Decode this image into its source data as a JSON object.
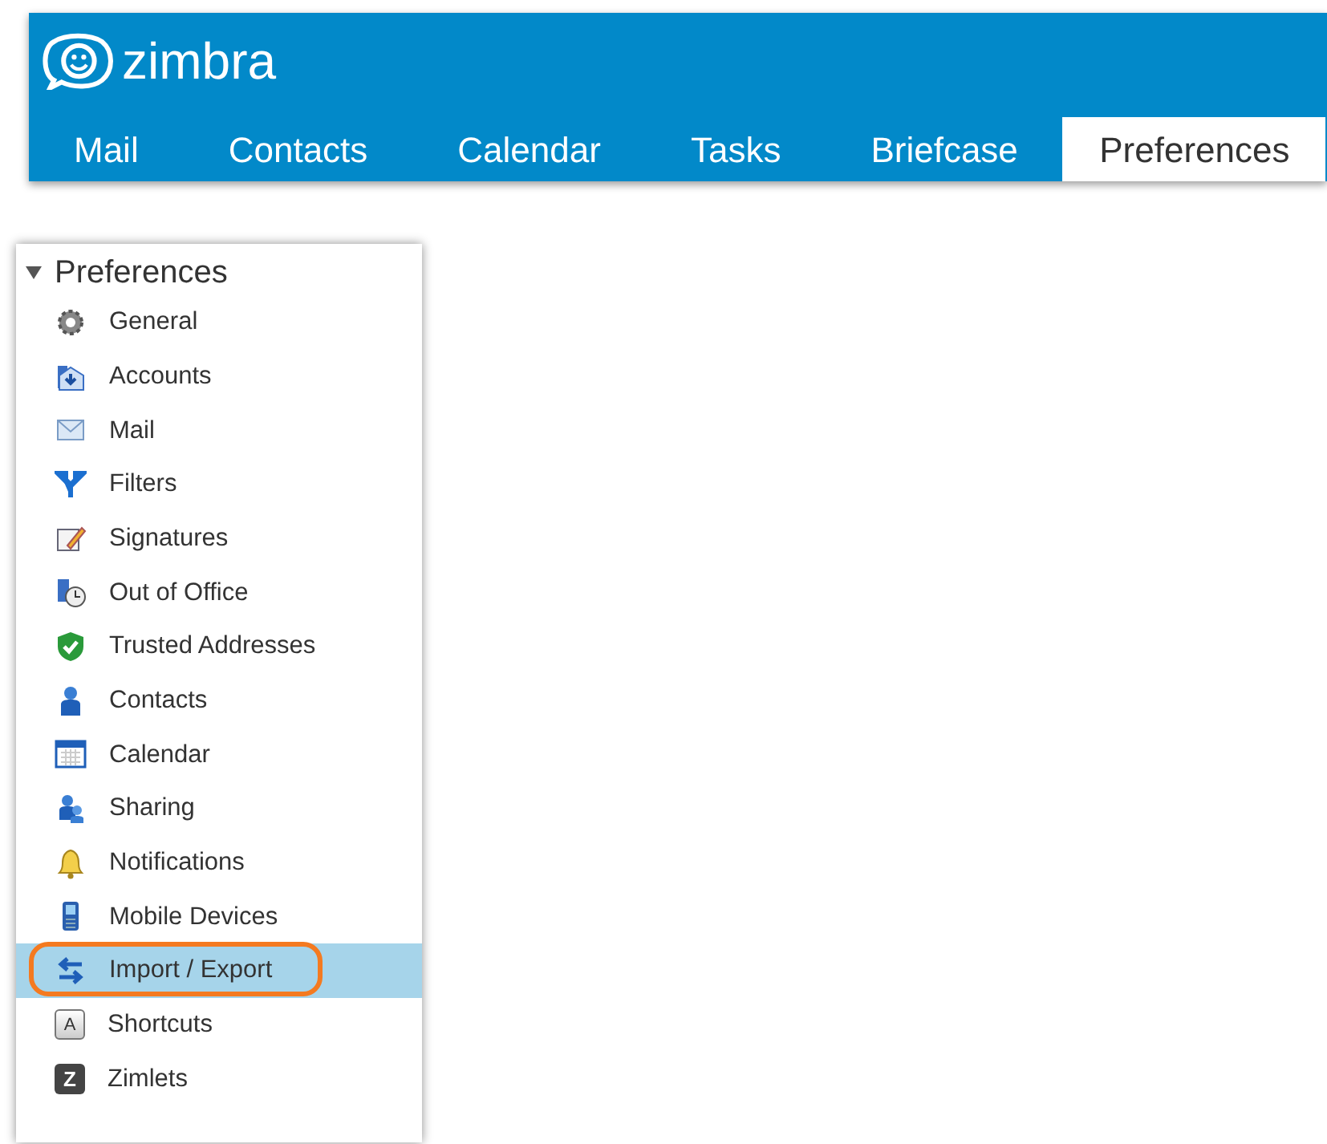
{
  "app": {
    "logo": "zimbra"
  },
  "tabs": [
    {
      "label": "Mail",
      "selected": false
    },
    {
      "label": "Contacts",
      "selected": false
    },
    {
      "label": "Calendar",
      "selected": false
    },
    {
      "label": "Tasks",
      "selected": false
    },
    {
      "label": "Briefcase",
      "selected": false
    },
    {
      "label": "Preferences",
      "selected": true
    }
  ],
  "sidebar": {
    "title": "Preferences",
    "expanded": true,
    "items": [
      {
        "label": "General",
        "kind": "gear",
        "selected": false,
        "circled": false
      },
      {
        "label": "Accounts",
        "kind": "accounts",
        "selected": false,
        "circled": false
      },
      {
        "label": "Mail",
        "kind": "envelope",
        "selected": false,
        "circled": false
      },
      {
        "label": "Filters",
        "kind": "filter",
        "selected": false,
        "circled": false
      },
      {
        "label": "Signatures",
        "kind": "signature",
        "selected": false,
        "circled": false
      },
      {
        "label": "Out of Office",
        "kind": "clock",
        "selected": false,
        "circled": false
      },
      {
        "label": "Trusted Addresses",
        "kind": "shield",
        "selected": false,
        "circled": false
      },
      {
        "label": "Contacts",
        "kind": "person",
        "selected": false,
        "circled": false
      },
      {
        "label": "Calendar",
        "kind": "calendar",
        "selected": false,
        "circled": false
      },
      {
        "label": "Sharing",
        "kind": "people",
        "selected": false,
        "circled": false
      },
      {
        "label": "Notifications",
        "kind": "bell",
        "selected": false,
        "circled": false
      },
      {
        "label": "Mobile Devices",
        "kind": "phone",
        "selected": false,
        "circled": false
      },
      {
        "label": "Import / Export",
        "kind": "arrows",
        "selected": true,
        "circled": true
      },
      {
        "label": "Shortcuts",
        "kind": "key",
        "icon_text": "A",
        "selected": false,
        "circled": false
      },
      {
        "label": "Zimlets",
        "kind": "zimlet",
        "icon_text": "Z",
        "selected": false,
        "circled": false
      }
    ]
  }
}
